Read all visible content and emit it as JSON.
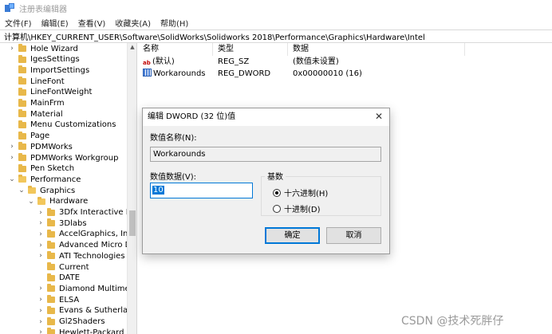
{
  "window": {
    "title": "注册表编辑器",
    "icon": "regedit-icon"
  },
  "menu": [
    "文件(F)",
    "编辑(E)",
    "查看(V)",
    "收藏夹(A)",
    "帮助(H)"
  ],
  "address": "计算机\\HKEY_CURRENT_USER\\Software\\SolidWorks\\Solidworks 2018\\Performance\\Graphics\\Hardware\\Intel",
  "tree": [
    {
      "label": "Hole Wizard",
      "expander": "collapsed"
    },
    {
      "label": "IgesSettings",
      "expander": "none"
    },
    {
      "label": "ImportSettings",
      "expander": "none"
    },
    {
      "label": "LineFont",
      "expander": "none"
    },
    {
      "label": "LineFontWeight",
      "expander": "none"
    },
    {
      "label": "MainFrm",
      "expander": "none"
    },
    {
      "label": "Material",
      "expander": "none"
    },
    {
      "label": "Menu Customizations",
      "expander": "none"
    },
    {
      "label": "Page",
      "expander": "none"
    },
    {
      "label": "PDMWorks",
      "expander": "collapsed"
    },
    {
      "label": "PDMWorks Workgroup",
      "expander": "collapsed"
    },
    {
      "label": "Pen Sketch",
      "expander": "none"
    },
    {
      "label": "Performance",
      "expander": "expanded"
    },
    {
      "label": "Graphics",
      "expander": "expanded"
    },
    {
      "label": "Hardware",
      "expander": "expanded"
    },
    {
      "label": "3Dfx Interactive In",
      "expander": "collapsed"
    },
    {
      "label": "3Dlabs",
      "expander": "collapsed"
    },
    {
      "label": "AccelGraphics, Inc",
      "expander": "collapsed"
    },
    {
      "label": "Advanced Micro D",
      "expander": "collapsed"
    },
    {
      "label": "ATI Technologies",
      "expander": "collapsed"
    },
    {
      "label": "Current",
      "expander": "none"
    },
    {
      "label": "DATE",
      "expander": "none"
    },
    {
      "label": "Diamond Multime",
      "expander": "collapsed"
    },
    {
      "label": "ELSA",
      "expander": "collapsed"
    },
    {
      "label": "Evans & Sutherlan",
      "expander": "collapsed"
    },
    {
      "label": "Gl2Shaders",
      "expander": "collapsed"
    },
    {
      "label": "Hewlett-Packard C",
      "expander": "collapsed"
    }
  ],
  "list": {
    "columns": [
      "名称",
      "类型",
      "数据"
    ],
    "rows": [
      {
        "name": "(默认)",
        "type": "REG_SZ",
        "data": "(数值未设置)",
        "icon": "reg-sz-icon",
        "icon_text": "ab"
      },
      {
        "name": "Workarounds",
        "type": "REG_DWORD",
        "data": "0x00000010 (16)",
        "icon": "reg-dword-icon"
      }
    ]
  },
  "dialog": {
    "title": "编辑 DWORD (32 位)值",
    "value_name_label": "数值名称(N):",
    "value_name": "Workarounds",
    "value_data_label": "数值数据(V):",
    "value_data": "10",
    "base_label": "基数",
    "radio_hex": "十六进制(H)",
    "radio_dec": "十进制(D)",
    "selected_base": "hex",
    "ok": "确定",
    "cancel": "取消"
  },
  "watermark": "CSDN @技术死胖仔"
}
